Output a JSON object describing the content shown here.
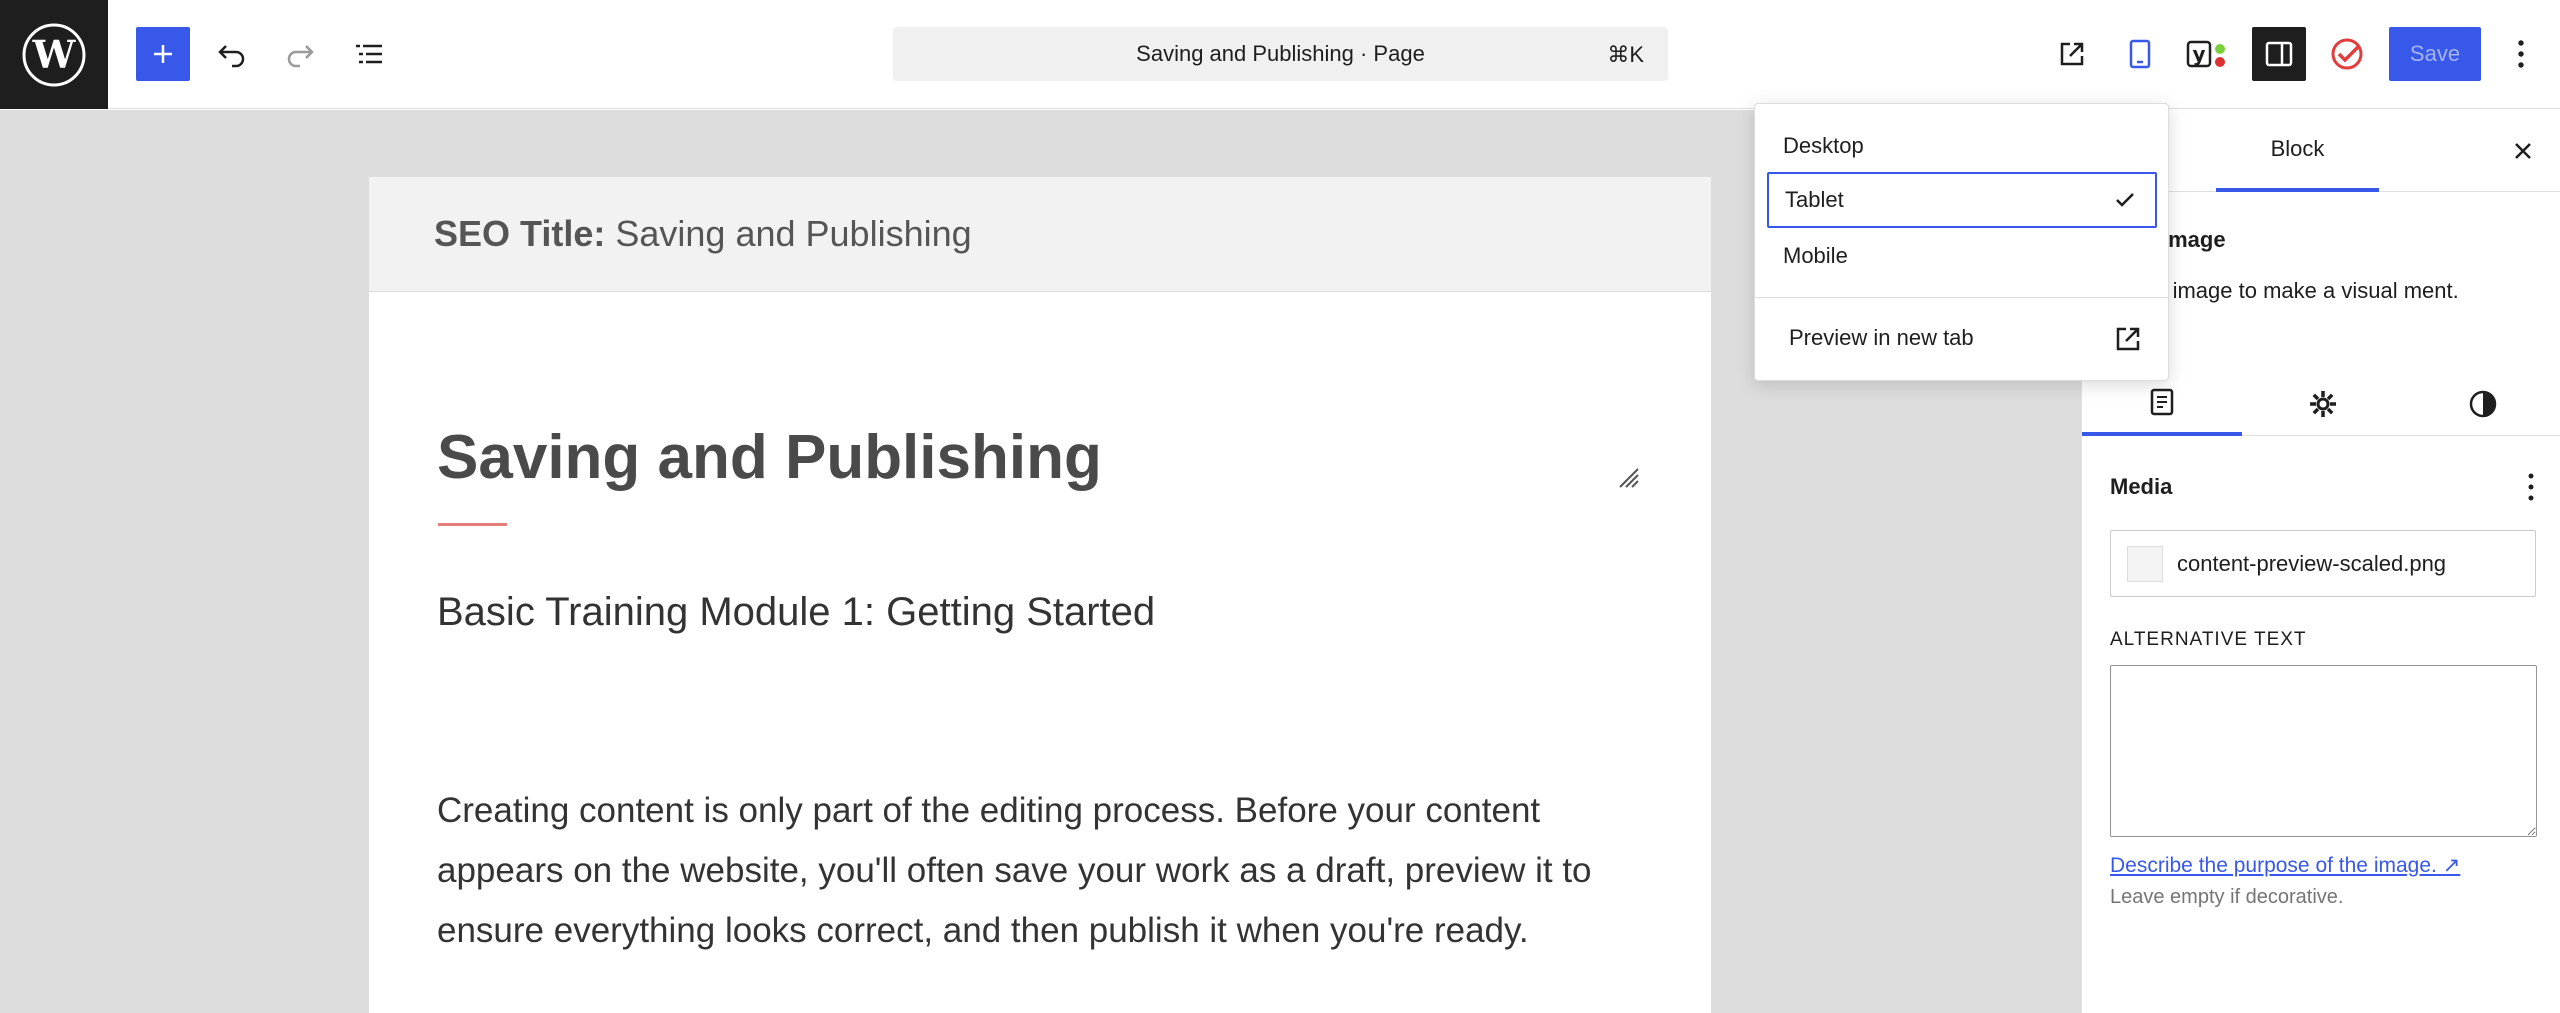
{
  "toolbar": {
    "document_title": "Saving and Publishing · Page",
    "shortcut": "⌘K",
    "save_label": "Save",
    "icons": [
      "wordpress-logo-icon",
      "add-block-icon",
      "undo-icon",
      "redo-icon",
      "document-overview-icon",
      "view-page-icon",
      "device-preview-icon",
      "yoast-seo-icon",
      "settings-sidebar-icon",
      "editorial-check-icon",
      "options-icon"
    ]
  },
  "editor": {
    "seo_label": "SEO Title:",
    "seo_value": "Saving and Publishing",
    "page_title": "Saving and Publishing",
    "subtitle": "Basic Training Module 1: Getting Started",
    "paragraph": "Creating content is only part of the editing process. Before your content appears on the website, you'll often save your work as a draft, preview it to ensure everything looks correct, and then publish it when you're ready."
  },
  "preview_menu": {
    "items": [
      {
        "label": "Desktop",
        "selected": false
      },
      {
        "label": "Tablet",
        "selected": true
      },
      {
        "label": "Mobile",
        "selected": false
      }
    ],
    "preview_new_tab": "Preview in new tab"
  },
  "sidebar": {
    "tab_block": "Block",
    "block_name": "Image",
    "block_description": "an image to make a visual ment.",
    "media_label": "Media",
    "media_file": "content-preview-scaled.png",
    "alt_text_label": "ALTERNATIVE TEXT",
    "alt_text_value": "",
    "alt_link": "Describe the purpose of the image.",
    "alt_help": "Leave empty if decorative."
  },
  "colors": {
    "accent": "#3858e9",
    "dark": "#1e1e1e",
    "canvas_bg": "#dddddd",
    "title_rule": "#d9534f"
  }
}
